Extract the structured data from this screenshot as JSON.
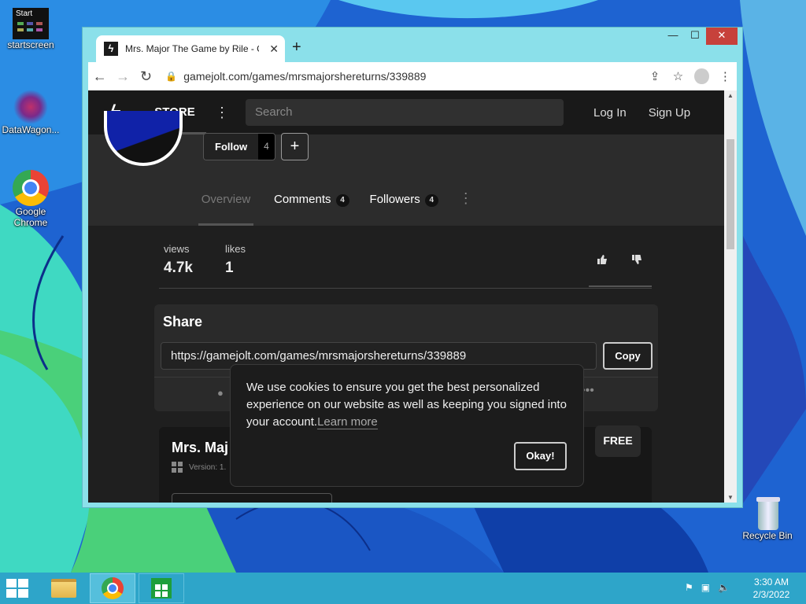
{
  "desktop": {
    "icons": [
      {
        "label": "startscreen"
      },
      {
        "label": "DataWagon..."
      },
      {
        "label": "Google Chrome"
      },
      {
        "label": "Recycle Bin"
      }
    ],
    "start_tile_text": "Start"
  },
  "browser": {
    "tab_title": "Mrs. Major The Game by Rile - G",
    "url": "gamejolt.com/games/mrsmajorshereturns/339889"
  },
  "gamejolt": {
    "store_label": "STORE",
    "search_placeholder": "Search",
    "login_label": "Log In",
    "signup_label": "Sign Up",
    "follow_label": "Follow",
    "follow_count": "4",
    "add_label": "+",
    "tabs": [
      {
        "label": "Overview"
      },
      {
        "label": "Comments",
        "count": "4"
      },
      {
        "label": "Followers",
        "count": "4"
      }
    ],
    "stats": {
      "views_label": "views",
      "views_value": "4.7k",
      "likes_label": "likes",
      "likes_value": "1"
    },
    "share": {
      "title": "Share",
      "url": "https://gamejolt.com/games/mrsmajorshereturns/339889",
      "copy_label": "Copy"
    },
    "game": {
      "name": "Mrs. Maj",
      "version_label": "Version: 1.",
      "price_label": "FREE"
    },
    "cookie": {
      "text": "We use cookies to ensure you get the best personalized experience on our website as well as keeping you signed into your account.",
      "link": "Learn more",
      "ok_label": "Okay!"
    }
  },
  "taskbar": {
    "time": "3:30 AM",
    "date": "2/3/2022"
  },
  "colors": {
    "taskbar": "#2ea5c9",
    "window_frame": "#8be0ea",
    "close_button": "#c7413b",
    "gj_background": "#1f1f1f"
  }
}
